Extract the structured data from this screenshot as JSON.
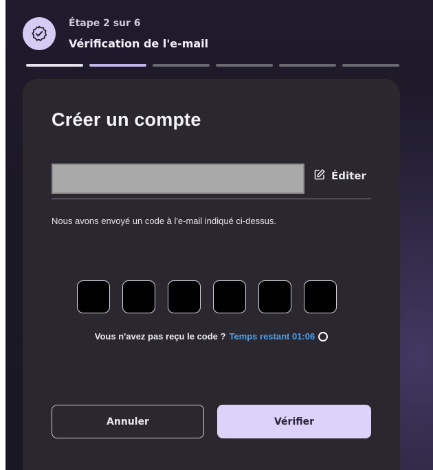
{
  "header": {
    "step_label": "Étape 2 sur 6",
    "step_title": "Vérification de l'e-mail",
    "progress": {
      "total_steps": 6,
      "current_step": 2
    }
  },
  "card": {
    "title": "Créer un compte",
    "edit_label": "Éditer",
    "info_text": "Nous avons envoyé un code à l'e-mail indiqué ci-dessus.",
    "otp_digits": 6,
    "resend_question": "Vous n'avez pas reçu le code ?",
    "timer_text": "Temps restant 01:06",
    "cancel_label": "Annuler",
    "verify_label": "Vérifier"
  },
  "icons": {
    "step_badge": "check-badge-icon",
    "edit": "edit-icon",
    "spinner": "loading-spinner-icon"
  },
  "colors": {
    "accent": "#ddd2fa",
    "timer": "#4f9fe7",
    "card": "#2a282e"
  }
}
